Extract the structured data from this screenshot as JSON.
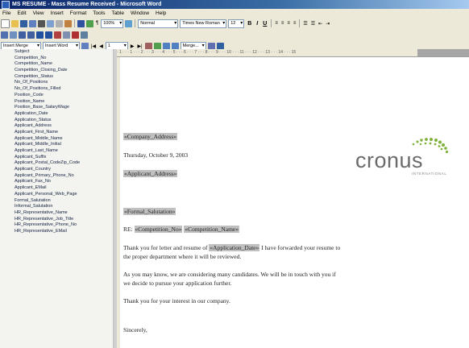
{
  "window": {
    "title": "MS RESUME - Mass Resume Received - Microsoft Word"
  },
  "menu": [
    "File",
    "Edit",
    "View",
    "Insert",
    "Format",
    "Tools",
    "Table",
    "Window",
    "Help"
  ],
  "toolbar": {
    "zoom": "100%",
    "style": "Normal",
    "font": "Times New Roman",
    "size": "12",
    "bold": "B",
    "italic": "I",
    "underline": "U"
  },
  "mailmerge": {
    "insert_merge_field": "Insert Merge Field",
    "insert_word_field": "Insert Word Field",
    "record_number": "1",
    "merge_label": "Merge..."
  },
  "fields": [
    "Subject",
    "Competition_No",
    "Competition_Name",
    "Competition_Closing_Date",
    "Competition_Status",
    "No_Of_Positions",
    "No_Of_Positions_Filled",
    "Position_Code",
    "Position_Name",
    "Position_Base_SalaryWage",
    "Application_Date",
    "Application_Status",
    "Applicant_Address",
    "Applicant_First_Name",
    "Applicant_Middle_Name",
    "Applicant_Middle_Initial",
    "Applicant_Last_Name",
    "Applicant_Suffix",
    "Applicant_Postal_CodeZip_Code",
    "Applicant_Country",
    "Applicant_Primary_Phone_No",
    "Applicant_Fax_No",
    "Applicant_EMail",
    "Applicant_Personal_Web_Page",
    "Formal_Salutation",
    "Informal_Salutation",
    "HR_Representative_Name",
    "HR_Representative_Job_Title",
    "HR_Representative_Phone_No",
    "HR_Representative_EMail"
  ],
  "ruler_text": "· 1 · · · 1 · · · 2 · · · 3 · · · 4 · · · 5 · · · 6 · · · 7 · · · 8 · · · 9 · · · 10 · · · 11 · · · 12 · · · 13 · · · 14 · · · 15",
  "document": {
    "company_address": "«Company_Address»",
    "date": "Thursday, October 9, 2003",
    "applicant_address": "«Applicant_Address»",
    "salutation": "«Formal_Salutation»",
    "re_label": "RE:",
    "competition_no": "«Competition_No»",
    "competition_name": "«Competition_Name»",
    "para1_start": "Thank you for letter and resume of ",
    "application_date": "«Application_Date»",
    "para1_end": " I have forwarded your resume to",
    "para1_line2": "the proper department where it will be reviewed.",
    "para2_line1": "As you may know, we are considering many candidates. We will be in touch with you if",
    "para2_line2": "we decide to pursue your application further.",
    "para3": "Thank you for your interest in our company.",
    "closing": "Sincerely,"
  },
  "logo": {
    "name": "cronus",
    "tagline": "INTERNATIONAL"
  },
  "colors": {
    "titlebar": "#0a246a",
    "logo_green": "#7fb03a",
    "logo_gray": "#6b6b6b",
    "merge_highlight": "#c0c0c0"
  }
}
